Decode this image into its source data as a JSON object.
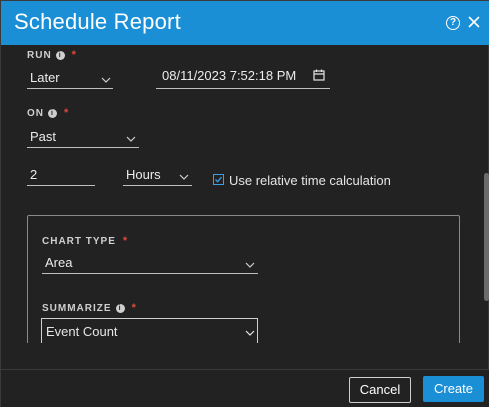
{
  "dialog": {
    "title": "Schedule Report",
    "help_icon": "help-circle-icon",
    "close_icon": "close-icon"
  },
  "run": {
    "label": "RUN",
    "value": "Later",
    "datetime": "08/11/2023 7:52:18 PM",
    "calendar_icon": "calendar-icon"
  },
  "on": {
    "label": "ON",
    "value": "Past",
    "amount": "2",
    "unit": "Hours",
    "relative_label": "Use relative time calculation",
    "relative_checked": true
  },
  "chart_type": {
    "label": "CHART TYPE",
    "value": "Area"
  },
  "summarize": {
    "label": "SUMMARIZE",
    "value": "Event Count"
  },
  "footer": {
    "cancel_label": "Cancel",
    "create_label": "Create"
  },
  "colors": {
    "accent": "#1a8fd6",
    "required": "#e0483b",
    "background": "#222222"
  }
}
